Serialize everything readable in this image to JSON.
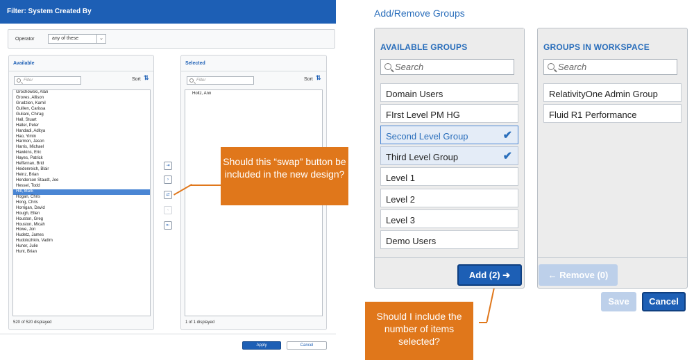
{
  "left_dialog": {
    "title": "Filter: System Created By",
    "operator": {
      "label": "Operator",
      "value": "any of these"
    },
    "available": {
      "title": "Available",
      "filter_placeholder": "Filter",
      "sort_label": "Sort",
      "sort_icon": "sort-az-icon",
      "items": [
        "Grochowski, Alan",
        "Groves, Allison",
        "Grudzien, Kamil",
        "Guillen, Carissa",
        "Guliani, Chirag",
        "Hall, Stuart",
        "Haller, Peter",
        "Handadi, Aditya",
        "Hao, Yimin",
        "Harmon, Jason",
        "Harris, Michael",
        "Hawkins, Eric",
        "Hayes, Patrick",
        "Heffernan, Brid",
        "Heidenreich, Blair",
        "Heinz, Brian",
        "Henderson Staudt, Joe",
        "Hessel, Todd",
        "Hill, Mark",
        "Hogan, Chris",
        "Hong, Chris",
        "Horrigan, David",
        "Hough, Ellen",
        "Houston, Greg",
        "Houston, Micah",
        "Howe, Jon",
        "Hudetz, James",
        "Hudolozhkin, Vadim",
        "Huner, Julie",
        "Hunt, Brian"
      ],
      "selected_item": "Hill, Mark",
      "footer": "520 of 520 displayed"
    },
    "selected": {
      "title": "Selected",
      "filter_placeholder": "Filter",
      "sort_label": "Sort",
      "items": [
        "Holtz, Ann"
      ],
      "footer": "1 of 1 displayed"
    },
    "transfer_buttons": [
      {
        "name": "move-all-right",
        "glyph": "⇥"
      },
      {
        "name": "move-right",
        "glyph": "›"
      },
      {
        "name": "swap",
        "glyph": "⇄"
      },
      {
        "name": "move-left",
        "glyph": "‹"
      },
      {
        "name": "move-all-left",
        "glyph": "⇤"
      }
    ],
    "apply_label": "Apply",
    "cancel_label": "Cancel"
  },
  "callouts": {
    "swap_question": "Should this “swap” button be included in the new design?",
    "count_question": "Should I include the number of items selected?"
  },
  "right_dialog": {
    "title": "Add/Remove Groups",
    "available_groups": {
      "title": "AVAILABLE GROUPS",
      "search_placeholder": "Search",
      "items": [
        {
          "label": "Domain Users",
          "checked": false
        },
        {
          "label": "FIrst Level PM HG",
          "checked": false
        },
        {
          "label": "Second Level Group",
          "checked": true
        },
        {
          "label": "Third Level Group",
          "checked": true
        },
        {
          "label": "Level 1",
          "checked": false
        },
        {
          "label": "Level 2",
          "checked": false
        },
        {
          "label": "Level 3",
          "checked": false
        },
        {
          "label": "Demo Users",
          "checked": false
        }
      ]
    },
    "groups_in_workspace": {
      "title": "GROUPS IN WORKSPACE",
      "search_placeholder": "Search",
      "items": [
        "RelativityOne Admin Group",
        "Fluid R1 Performance"
      ]
    },
    "add_label": "Add (2) ➔",
    "remove_label": "← Remove (0)",
    "save_label": "Save",
    "cancel_label": "Cancel"
  },
  "colors": {
    "primary": "#1d5fb5",
    "callout": "#e0771b",
    "selection": "#4a86d4"
  }
}
